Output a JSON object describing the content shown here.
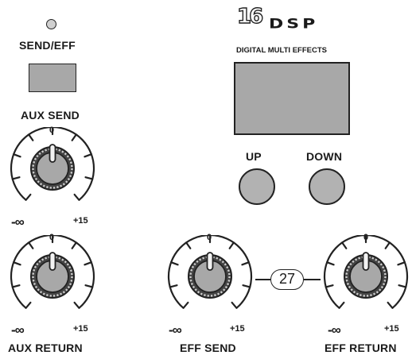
{
  "send_eff": {
    "label": "SEND/EFF"
  },
  "aux_send": {
    "label": "AUX SEND",
    "scale_top": "0",
    "scale_min": "-∞",
    "scale_max": "+15"
  },
  "aux_return": {
    "label": "AUX RETURN",
    "scale_top": "0",
    "scale_min": "-∞",
    "scale_max": "+15"
  },
  "eff_send": {
    "label": "EFF SEND",
    "scale_top": "0",
    "scale_min": "-∞",
    "scale_max": "+15"
  },
  "eff_return": {
    "label": "EFF RETURN",
    "scale_top": "0",
    "scale_min": "-∞",
    "scale_max": "+15"
  },
  "dsp": {
    "logo_number": "16",
    "logo_text": "DSP",
    "subtitle": "DIGITAL MULTI EFFECTS",
    "up_label": "UP",
    "down_label": "DOWN"
  },
  "badge": {
    "value": "27"
  },
  "colors": {
    "panel": "#ffffff",
    "control_fill": "#a8a8a8",
    "outline": "#222222"
  }
}
